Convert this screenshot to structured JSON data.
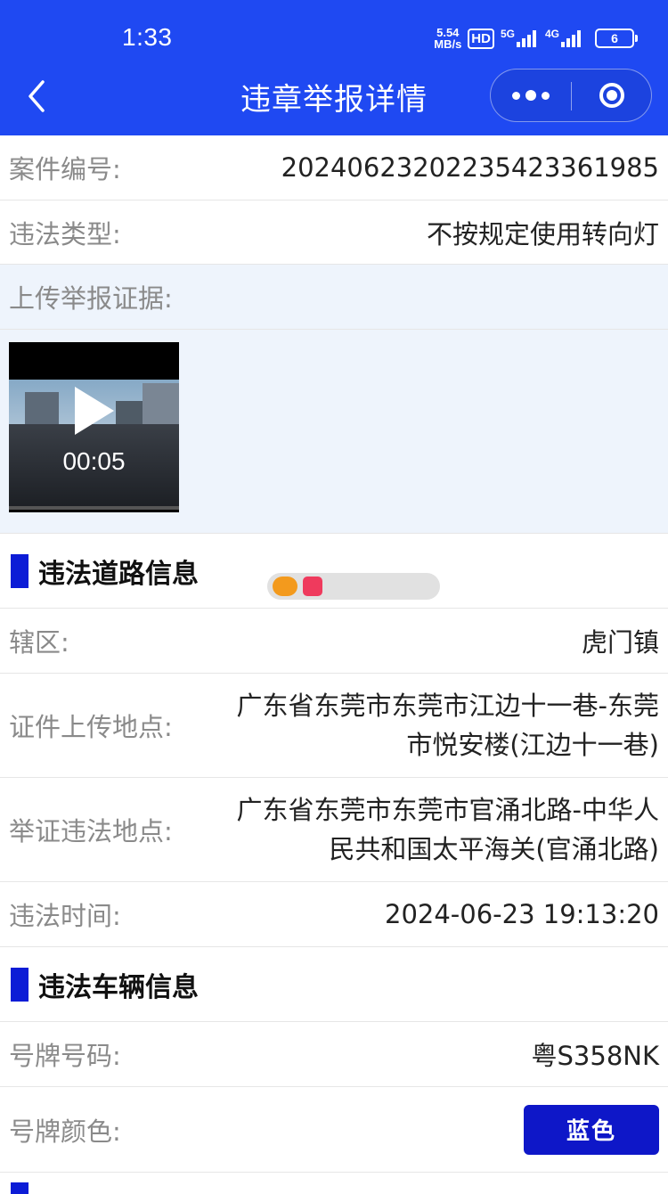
{
  "status_bar": {
    "time": "1:33",
    "net_speed_value": "5.54",
    "net_speed_unit": "MB/s",
    "hd_badge": "HD",
    "sig1_label": "5G",
    "sig2_label": "4G",
    "battery": "6"
  },
  "nav": {
    "title": "违章举报详情",
    "back_icon": "chevron-left-icon",
    "more_icon": "more-dots-icon",
    "close_icon": "miniprogram-close-icon"
  },
  "case": {
    "number_label": "案件编号:",
    "number_value": "2024062320223542336198​5",
    "type_label": "违法类型:",
    "type_value": "不按规定使用转向灯",
    "evidence_label": "上传举报证据:",
    "video_duration": "00:05"
  },
  "road_section": {
    "title": "违法道路信息",
    "district_label": "辖区:",
    "district_value": "虎门镇",
    "upload_location_label": "证件上传地点:",
    "upload_location_line1": "广东省东莞市东莞市江边十一巷-东莞",
    "upload_location_line2": "市悦安楼(江边十一巷)",
    "violation_location_label": "举证违法地点:",
    "violation_location_line1": "广东省东莞市东莞市官涌北路-中华人",
    "violation_location_line2": "民共和国太平海关(官涌北路)",
    "time_label": "违法时间:",
    "time_value": "2024-06-23 19:13:20"
  },
  "vehicle_section": {
    "title": "违法车辆信息",
    "plate_number_label": "号牌号码:",
    "plate_number_value": "粤S358NK",
    "plate_color_label": "号牌颜色:",
    "plate_color_value": "蓝色"
  },
  "colors": {
    "primary": "#1f49f2",
    "section_bar": "#0c1cd6",
    "plate_blue": "#0e17c8",
    "label_gray": "#8a8a8a",
    "light_bg": "#eef4fc"
  }
}
